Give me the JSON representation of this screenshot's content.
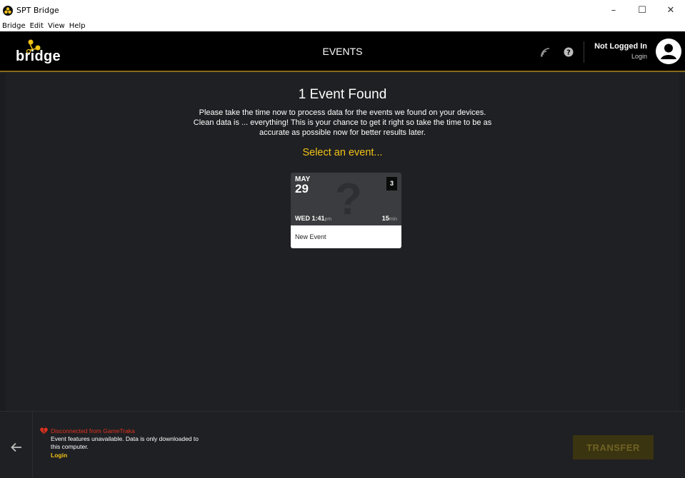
{
  "window": {
    "title": "SPT Bridge",
    "controls": {
      "minimize": "–",
      "maximize": "☐",
      "close": "✕"
    }
  },
  "menu": {
    "items": [
      "Bridge",
      "Edit",
      "View",
      "Help"
    ]
  },
  "header": {
    "logo_text": "bridge",
    "title": "EVENTS",
    "user_status": "Not Logged In",
    "login_label": "Login"
  },
  "main": {
    "heading": "1 Event Found",
    "description": "Please take the time now to process data for the events we found on your devices. Clean data is ... everything! This is your chance to get it right so take the time to be as accurate as possible now for better results later.",
    "select_prompt": "Select an event..."
  },
  "events": [
    {
      "month": "MAY",
      "day": "29",
      "count": "3",
      "weekday": "WED",
      "time": "1:41",
      "time_suffix": "pm",
      "duration": "15",
      "duration_unit": "min",
      "name": "New Event",
      "placeholder_glyph": "?"
    }
  ],
  "footer": {
    "back_icon": "arrow-left-icon",
    "status_title": "Disconnected from GameTraka",
    "status_desc": "Event features unavailable. Data is only downloaded to this computer.",
    "status_login": "Login",
    "transfer_label": "TRANSFER"
  },
  "colors": {
    "accent": "#f2c316",
    "error": "#e0321e",
    "background": "#1f2023",
    "header_bg": "#000000"
  }
}
